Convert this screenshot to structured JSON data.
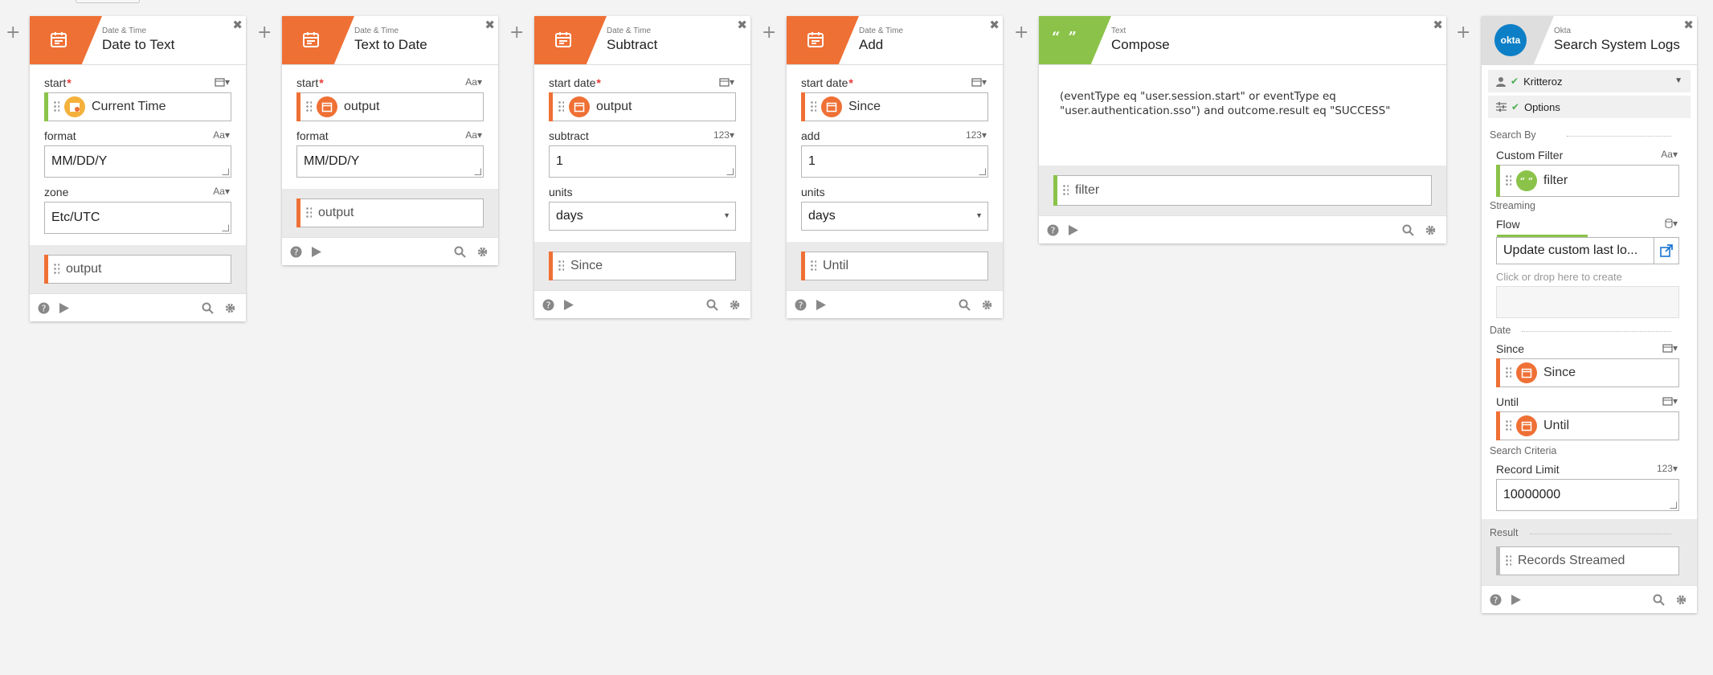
{
  "colors": {
    "accent_orange": "#ef7035",
    "accent_green": "#8bc34a",
    "okta_blue": "#0d7fc7"
  },
  "cards": [
    {
      "category": "Date & Time",
      "title": "Date to Text",
      "fields": [
        {
          "label": "start",
          "required": true,
          "type": "calendar-icon",
          "pill_text": "Current Time"
        },
        {
          "label": "format",
          "type": "Aa",
          "value": "MM/DD/Y"
        },
        {
          "label": "zone",
          "type": "Aa",
          "value": "Etc/UTC"
        }
      ],
      "output": "output"
    },
    {
      "category": "Date & Time",
      "title": "Text to Date",
      "fields": [
        {
          "label": "start",
          "required": true,
          "type": "Aa",
          "pill_text": "output"
        },
        {
          "label": "format",
          "type": "Aa",
          "value": "MM/DD/Y"
        }
      ],
      "output": "output"
    },
    {
      "category": "Date & Time",
      "title": "Subtract",
      "fields": [
        {
          "label": "start date",
          "required": true,
          "type": "calendar-icon",
          "pill_text": "output"
        },
        {
          "label": "subtract",
          "type": "123",
          "value": "1"
        },
        {
          "label": "units",
          "value": "days"
        }
      ],
      "output": "Since"
    },
    {
      "category": "Date & Time",
      "title": "Add",
      "fields": [
        {
          "label": "start date",
          "required": true,
          "type": "calendar-icon",
          "pill_text": "Since"
        },
        {
          "label": "add",
          "type": "123",
          "value": "1"
        },
        {
          "label": "units",
          "value": "days"
        }
      ],
      "output": "Until"
    },
    {
      "category": "Text",
      "title": "Compose",
      "body": "(eventType eq \"user.session.start\" or eventType eq \"user.authentication.sso\") and outcome.result eq \"SUCCESS\"",
      "output": "filter"
    },
    {
      "category": "Okta",
      "title": "Search System Logs",
      "logo_text": "okta",
      "connection": "Kritteroz",
      "options": "Options",
      "search_by": "Search By",
      "custom_filter": {
        "label": "Custom Filter",
        "type": "Aa",
        "pill_text": "filter"
      },
      "streaming": "Streaming",
      "flow": {
        "label": "Flow",
        "value": "Update custom last lo...",
        "progress": 0.5
      },
      "drop_hint": "Click or drop here to create",
      "date_section": "Date",
      "since": {
        "label": "Since",
        "pill_text": "Since"
      },
      "until": {
        "label": "Until",
        "pill_text": "Until"
      },
      "criteria_section": "Search Criteria",
      "record_limit": {
        "label": "Record Limit",
        "type": "123",
        "value": "10000000"
      },
      "result_section": "Result",
      "result": "Records Streamed"
    }
  ]
}
